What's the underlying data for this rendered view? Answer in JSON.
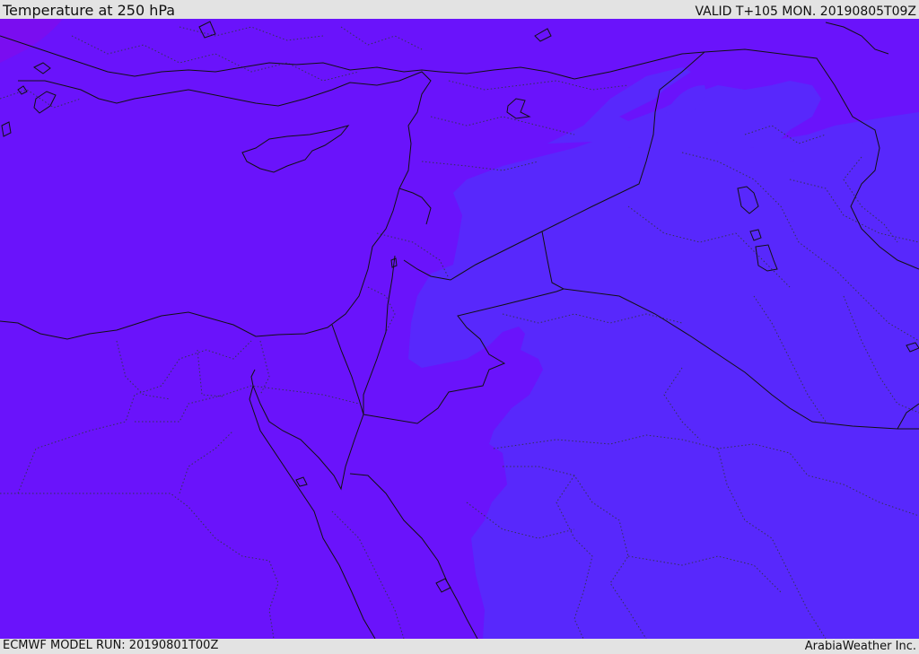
{
  "header": {
    "title": "Temperature at 250 hPa",
    "valid": "VALID T+105 MON. 20190805T09Z"
  },
  "footer": {
    "model_run": "ECMWF MODEL RUN: 20190801T00Z",
    "credit": "ArabiaWeather Inc."
  },
  "map": {
    "colors": {
      "field_cold": "#6a13fb",
      "field_warm": "#5828fc",
      "field_corner": "#7a0df0",
      "border": "#111111",
      "boundary_dotted": "#333355"
    },
    "icons": [
      "country-border-lines",
      "province-boundary-lines",
      "temperature-field"
    ]
  }
}
